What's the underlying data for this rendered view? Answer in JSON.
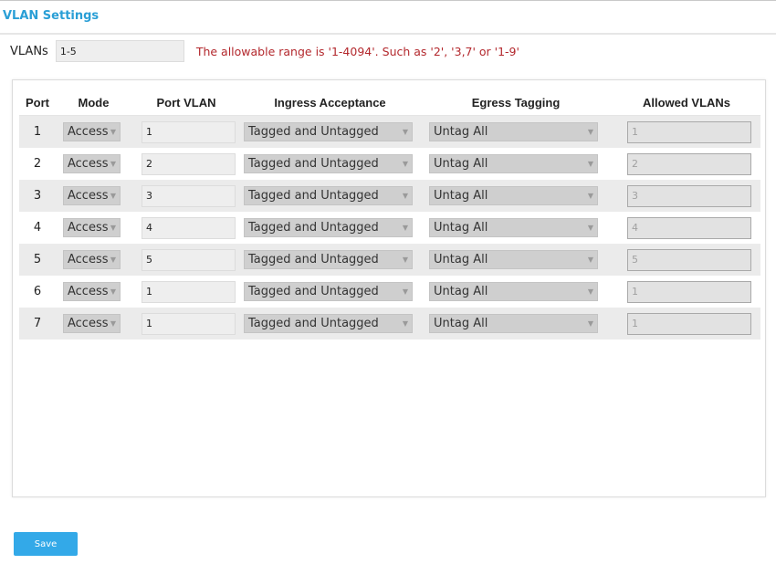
{
  "page": {
    "title": "VLAN Settings"
  },
  "vlans": {
    "label": "VLANs",
    "value": "1-5",
    "hint": "The allowable range is '1-4094'. Such as '2', '3,7' or '1-9'"
  },
  "table": {
    "headers": {
      "port": "Port",
      "mode": "Mode",
      "port_vlan": "Port VLAN",
      "ingress": "Ingress Acceptance",
      "egress": "Egress Tagging",
      "allowed": "Allowed VLANs"
    },
    "rows": [
      {
        "port": "1",
        "mode": "Access",
        "port_vlan": "1",
        "ingress": "Tagged and Untagged",
        "egress": "Untag All",
        "allowed": "1"
      },
      {
        "port": "2",
        "mode": "Access",
        "port_vlan": "2",
        "ingress": "Tagged and Untagged",
        "egress": "Untag All",
        "allowed": "2"
      },
      {
        "port": "3",
        "mode": "Access",
        "port_vlan": "3",
        "ingress": "Tagged and Untagged",
        "egress": "Untag All",
        "allowed": "3"
      },
      {
        "port": "4",
        "mode": "Access",
        "port_vlan": "4",
        "ingress": "Tagged and Untagged",
        "egress": "Untag All",
        "allowed": "4"
      },
      {
        "port": "5",
        "mode": "Access",
        "port_vlan": "5",
        "ingress": "Tagged and Untagged",
        "egress": "Untag All",
        "allowed": "5"
      },
      {
        "port": "6",
        "mode": "Access",
        "port_vlan": "1",
        "ingress": "Tagged and Untagged",
        "egress": "Untag All",
        "allowed": "1"
      },
      {
        "port": "7",
        "mode": "Access",
        "port_vlan": "1",
        "ingress": "Tagged and Untagged",
        "egress": "Untag All",
        "allowed": "1"
      }
    ]
  },
  "actions": {
    "save_label": "Save"
  },
  "icons": {
    "dropdown": "chevron-down-icon"
  },
  "colors": {
    "title": "#2a9fd6",
    "hint": "#b3282d",
    "save_button": "#33a9e8"
  }
}
